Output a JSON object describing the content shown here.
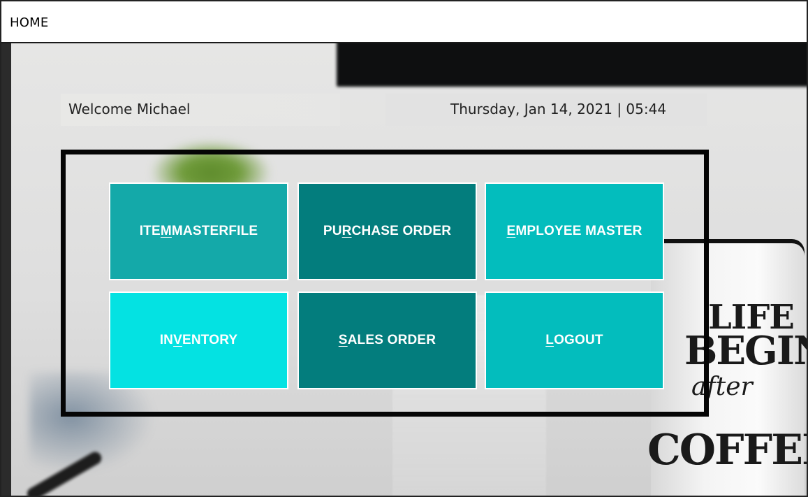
{
  "window": {
    "title": "HOME"
  },
  "header": {
    "welcome": "Welcome Michael",
    "datetime": "Thursday, Jan 14, 2021  |  05:44"
  },
  "background": {
    "mug_lines": [
      "LIFE",
      "BEGINS",
      "after",
      "COFFEE"
    ]
  },
  "menu": {
    "tiles": [
      {
        "pre": "ITE",
        "key": "M",
        "post": " MASTERFILE",
        "color": "#14a9a9"
      },
      {
        "pre": "PU",
        "key": "R",
        "post": "CHASE ORDER",
        "color": "#037d7d"
      },
      {
        "pre": "",
        "key": "E",
        "post": "MPLOYEE MASTER",
        "color": "#03bdbd"
      },
      {
        "pre": "IN",
        "key": "V",
        "post": "ENTORY",
        "color": "#04e2e2"
      },
      {
        "pre": "",
        "key": "S",
        "post": "ALES ORDER",
        "color": "#037d7d"
      },
      {
        "pre": "",
        "key": "L",
        "post": "OGOUT",
        "color": "#03bdbd"
      }
    ]
  }
}
